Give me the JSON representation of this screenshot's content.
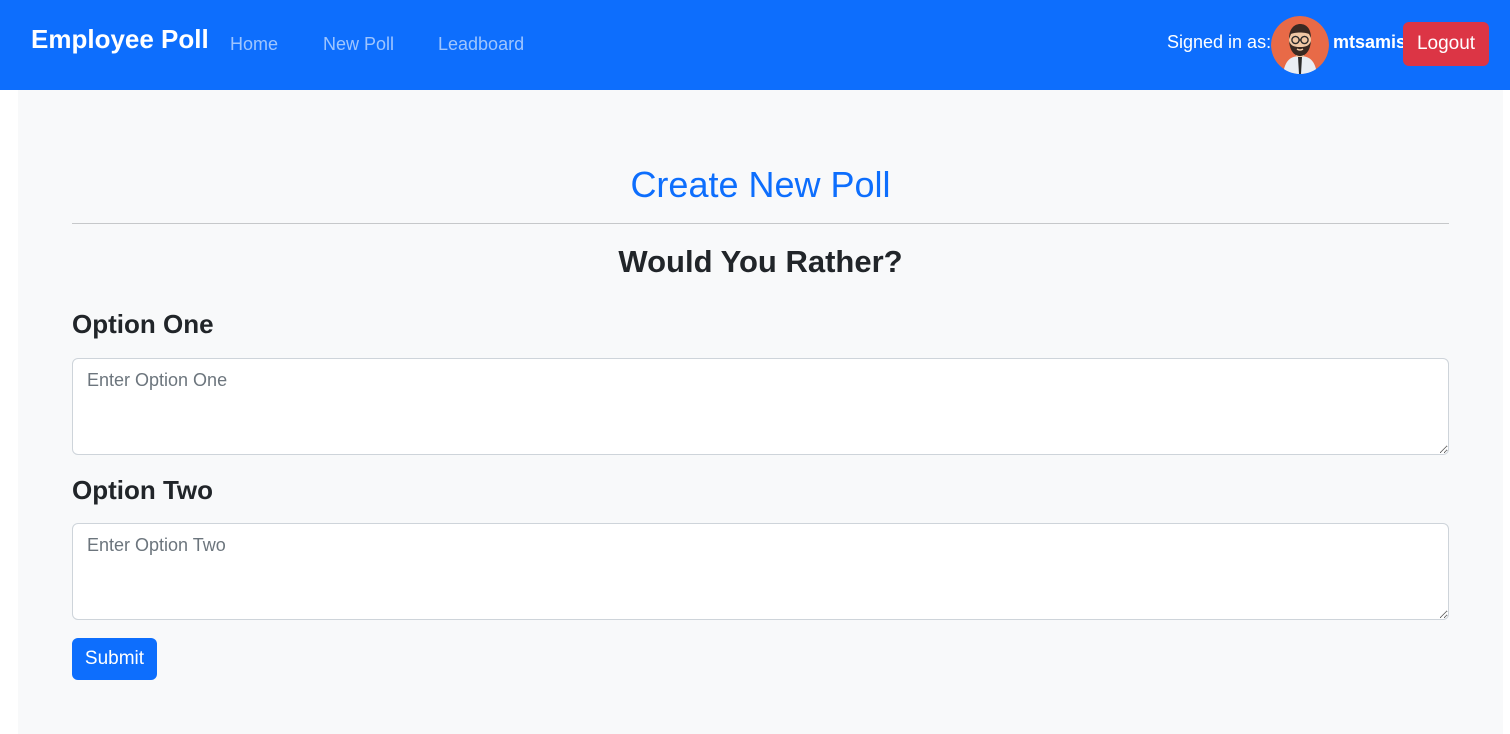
{
  "navbar": {
    "brand": "Employee Poll",
    "links": [
      "Home",
      "New Poll",
      "Leadboard"
    ],
    "signed_in_label": "Signed in as:",
    "username": "mtsamis",
    "logout_label": "Logout",
    "bg_color": "#0d6efd"
  },
  "main": {
    "title": "Create New Poll",
    "subtitle": "Would You Rather?",
    "option_one": {
      "label": "Option One",
      "placeholder": "Enter Option One",
      "value": ""
    },
    "option_two": {
      "label": "Option Two",
      "placeholder": "Enter Option Two",
      "value": ""
    },
    "submit_label": "Submit"
  },
  "colors": {
    "primary": "#0d6efd",
    "danger": "#dc3545"
  },
  "icons": {
    "avatar": "bearded-man-avatar"
  }
}
